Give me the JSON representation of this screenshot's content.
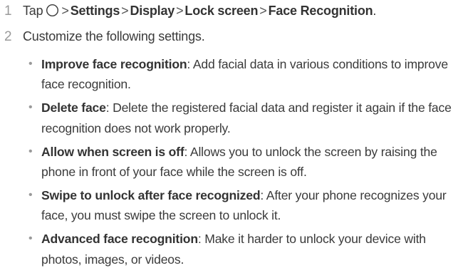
{
  "steps": [
    {
      "number": "1",
      "tap": "Tap",
      "icon": "circle-home-icon",
      "separator": ">",
      "path": [
        "Settings",
        "Display",
        "Lock screen",
        "Face Recognition"
      ],
      "period": "."
    },
    {
      "number": "2",
      "text": "Customize the following settings."
    }
  ],
  "settings": [
    {
      "term": "Improve face recognition",
      "desc": ": Add facial data in various conditions to improve face recognition."
    },
    {
      "term": "Delete face",
      "desc": ": Delete the registered facial data and register it again if the face recognition does not work properly."
    },
    {
      "term": "Allow when screen is off",
      "desc": ": Allows you to unlock the screen by raising the phone in front of your face while the screen is off."
    },
    {
      "term": "Swipe to unlock after face recognized",
      "desc": ": After your phone recognizes your face, you must swipe the screen to unlock it."
    },
    {
      "term": "Advanced face recognition",
      "desc": ": Make it harder to unlock your device with photos, images, or videos."
    }
  ]
}
